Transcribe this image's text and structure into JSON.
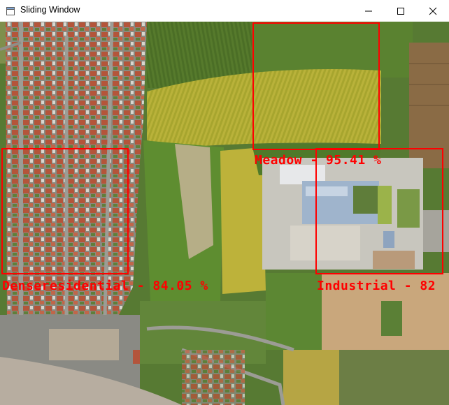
{
  "window": {
    "title": "Sliding Window"
  },
  "title_bar_icons": [
    "app-window-icon",
    "minimize-icon",
    "maximize-icon",
    "close-icon"
  ],
  "detections": [
    {
      "id": "meadow",
      "label": "Meadow - 95.41 %"
    },
    {
      "id": "denseresidential",
      "label": "Denseresidential - 84.05 %"
    },
    {
      "id": "industrial",
      "label": "Industrial - 82"
    }
  ],
  "colors": {
    "box": "#ff0000",
    "label": "#ff0000"
  }
}
